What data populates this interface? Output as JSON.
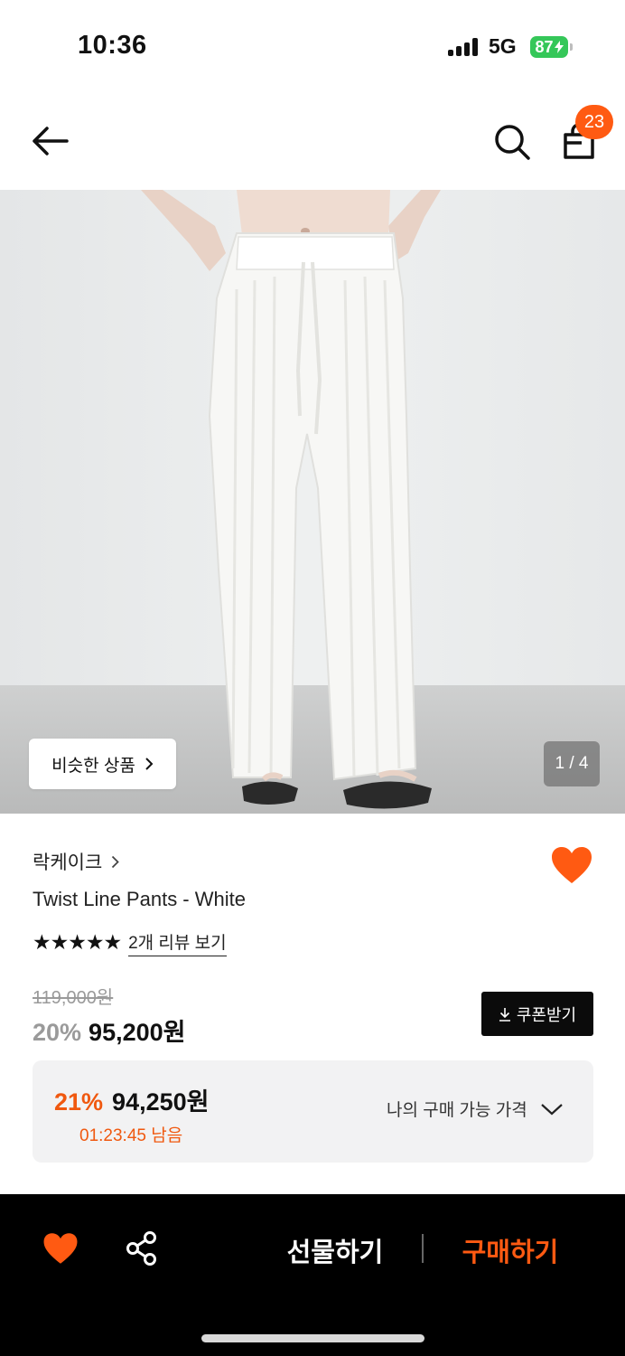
{
  "status_bar": {
    "time": "10:36",
    "network": "5G",
    "battery": "87"
  },
  "header": {
    "back_icon": "arrow-left-icon",
    "search_icon": "search-icon",
    "bag_icon": "shopping-bag-icon",
    "cart_count": "23"
  },
  "gallery": {
    "similar_label": "비슷한 상품",
    "page_indicator": "1 / 4"
  },
  "product": {
    "brand": "락케이크",
    "name": "Twist Line Pants - White",
    "rating_stars": 5,
    "review_label": "2개 리뷰 보기",
    "original_price": "119,000원",
    "discount_rate": "20%",
    "sale_price": "95,200원",
    "coupon_label": "쿠폰받기",
    "wishlisted": true
  },
  "my_price": {
    "rate": "21%",
    "price": "94,250원",
    "timer": "01:23:45 남음",
    "toggle_label": "나의 구매 가능 가격"
  },
  "bottom_bar": {
    "gift_label": "선물하기",
    "buy_label": "구매하기"
  },
  "colors": {
    "accent": "#ff5a12",
    "text": "#111111",
    "muted": "#9a9a9a",
    "panel": "#f2f2f3"
  }
}
